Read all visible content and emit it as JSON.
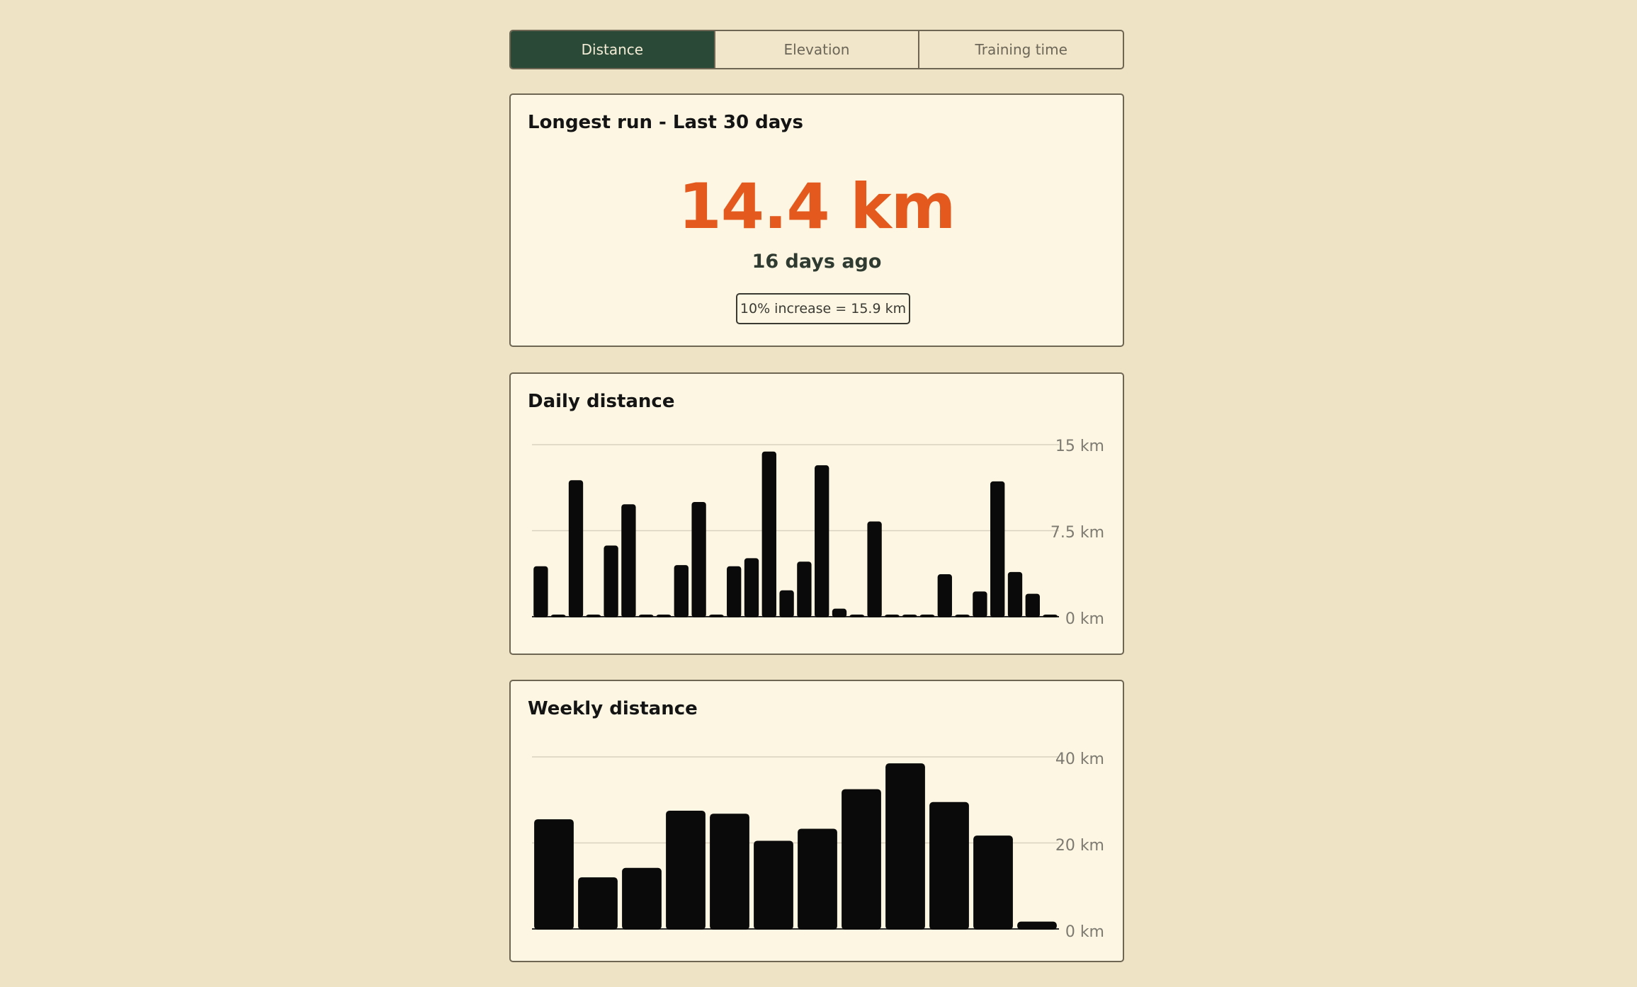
{
  "tabs": [
    {
      "label": "Distance",
      "active": true
    },
    {
      "label": "Elevation",
      "active": false
    },
    {
      "label": "Training time",
      "active": false
    }
  ],
  "longest_run": {
    "title": "Longest run - Last 30 days",
    "value": "14.4 km",
    "when": "16 days ago",
    "increase": "10% increase = 15.9 km"
  },
  "daily": {
    "title": "Daily distance",
    "ticks": [
      "0 km",
      "7.5 km",
      "15 km"
    ]
  },
  "weekly": {
    "title": "Weekly distance",
    "ticks": [
      "0 km",
      "20 km",
      "40 km"
    ]
  },
  "colors": {
    "background": "#efe3c6",
    "card": "#fdf6e3",
    "active_tab": "#2b4937",
    "accent": "#e45a1e",
    "bar": "#0a0a0a",
    "grid": "#d9d2c0"
  },
  "chart_data": [
    {
      "type": "bar",
      "title": "Daily distance",
      "ylim": [
        0,
        15
      ],
      "yticks": [
        0,
        7.5,
        15
      ],
      "values": [
        4.4,
        0,
        11.9,
        0,
        6.2,
        9.8,
        0,
        0,
        4.5,
        10,
        0,
        4.4,
        5.1,
        14.4,
        2.3,
        4.8,
        13.2,
        0.7,
        0,
        8.3,
        0,
        0,
        0,
        3.7,
        0,
        2.2,
        11.8,
        3.9,
        2,
        0
      ],
      "grid": true
    },
    {
      "type": "bar",
      "title": "Weekly distance",
      "ylim": [
        0,
        40
      ],
      "yticks": [
        0,
        20,
        40
      ],
      "values": [
        25.5,
        12,
        14.2,
        27.5,
        26.8,
        20.5,
        23.3,
        32.5,
        38.5,
        29.5,
        21.7,
        1.7
      ],
      "grid": true
    }
  ]
}
